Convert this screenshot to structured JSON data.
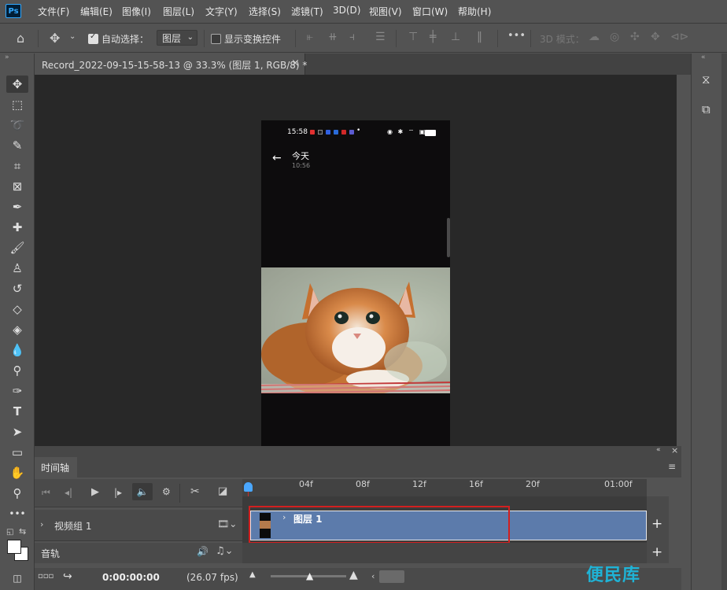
{
  "app": {
    "logo": "Ps"
  },
  "menu": [
    "文件(F)",
    "编辑(E)",
    "图像(I)",
    "图层(L)",
    "文字(Y)",
    "选择(S)",
    "滤镜(T)",
    "3D(D)",
    "视图(V)",
    "窗口(W)",
    "帮助(H)"
  ],
  "options": {
    "auto_select_label": "自动选择：",
    "auto_select_checked": true,
    "layer_select_value": "图层",
    "transform_controls_label": "显示变换控件",
    "transform_controls_checked": false,
    "mode_3d_label": "3D 模式：",
    "more": "•••"
  },
  "document": {
    "tab_title": "Record_2022-09-15-15-58-13 @ 33.3% (图层 1, RGB/8) *",
    "close": "×"
  },
  "phone": {
    "status_time": "15:58",
    "title": "今天",
    "subtitle": "10:56",
    "status_dot": "•"
  },
  "timeline": {
    "tab_label": "时间轴",
    "ruler_labels": [
      "04f",
      "08f",
      "12f",
      "16f",
      "20f",
      "01:00f"
    ],
    "video_group_label": "视频组 1",
    "audio_track_label": "音轨",
    "clip_label": "图层 1",
    "timecode": "0:00:00:00",
    "fps": "(26.07 fps)",
    "add": "+"
  },
  "watermark": "便民库",
  "colors": {
    "accent": "#31a8ff",
    "clip": "#5c7bab",
    "highlight": "#d21f1f",
    "canvas": "#282828"
  }
}
